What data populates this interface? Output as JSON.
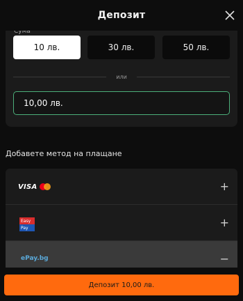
{
  "header": {
    "title": "Депозит",
    "close_icon": "close-icon"
  },
  "amount": {
    "label": "Сума",
    "presets": [
      {
        "label": "10 лв.",
        "selected": true
      },
      {
        "label": "30 лв.",
        "selected": false
      },
      {
        "label": "50 лв.",
        "selected": false
      }
    ],
    "divider_text": "или",
    "input_value": "10,00 лв."
  },
  "payment": {
    "section_title": "Добавете метод на плащане",
    "methods": [
      {
        "name": "VISA",
        "icon": "visa-mastercard-logo",
        "toggle": "+",
        "expanded": false
      },
      {
        "name": "Easy Pay",
        "logo_top": "Easy",
        "logo_bottom": "Pay",
        "icon": "easypay-logo",
        "toggle": "+",
        "expanded": false
      },
      {
        "name": "ePay.bg",
        "icon": "epay-logo",
        "toggle": "−",
        "expanded": true
      }
    ]
  },
  "footer": {
    "deposit_label": "Депозит 10,00 лв."
  },
  "colors": {
    "accent": "#ff6a0e",
    "input_border": "#4caf7a",
    "background": "#0d0d0d",
    "card": "#1b1b1b"
  }
}
